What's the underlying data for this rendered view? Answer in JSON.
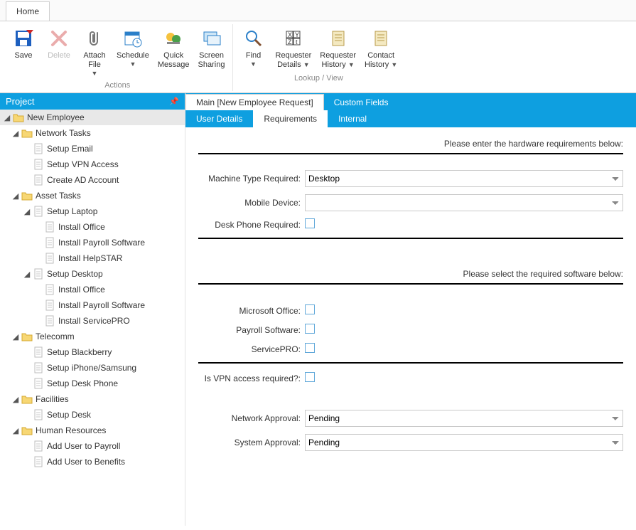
{
  "ribbon": {
    "tab": "Home",
    "buttons": {
      "save": "Save",
      "delete": "Delete",
      "attach": "Attach\nFile",
      "schedule": "Schedule",
      "quickmsg": "Quick\nMessage",
      "screen": "Screen\nSharing",
      "find": "Find",
      "reqdetails": "Requester\nDetails",
      "reqhistory": "Requester\nHistory",
      "contacthistory": "Contact\nHistory"
    },
    "group_actions": "Actions",
    "group_lookup": "Lookup / View"
  },
  "sidebar": {
    "title": "Project",
    "root": "New Employee",
    "items": [
      {
        "label": "Network Tasks",
        "children": [
          "Setup Email",
          "Setup VPN Access",
          "Create AD Account"
        ]
      },
      {
        "label": "Asset Tasks",
        "children": [
          {
            "label": "Setup Laptop",
            "children": [
              "Install Office",
              "Install Payroll Software",
              "Install HelpSTAR"
            ]
          },
          {
            "label": "Setup Desktop",
            "children": [
              "Install Office",
              "Install Payroll Software",
              "Install ServicePRO"
            ]
          }
        ]
      },
      {
        "label": "Telecomm",
        "children": [
          "Setup Blackberry",
          "Setup iPhone/Samsung",
          "Setup Desk Phone"
        ]
      },
      {
        "label": "Facilities",
        "children": [
          "Setup Desk"
        ]
      },
      {
        "label": "Human Resources",
        "children": [
          "Add User to Payroll",
          "Add User to Benefits"
        ]
      }
    ]
  },
  "tabs": {
    "main": "Main [New Employee Request]",
    "custom": "Custom Fields",
    "sub_user": "User Details",
    "sub_req": "Requirements",
    "sub_internal": "Internal"
  },
  "form": {
    "intro_hw": "Please enter the hardware requirements below:",
    "machine_type_label": "Machine Type Required:",
    "machine_type_value": "Desktop",
    "mobile_label": "Mobile Device:",
    "mobile_value": "",
    "desk_phone_label": "Desk Phone Required:",
    "intro_sw": "Please select the required software below:",
    "office_label": "Microsoft Office:",
    "payroll_label": "Payroll Software:",
    "servicepro_label": "ServicePRO:",
    "vpn_label": "Is VPN access required?:",
    "net_approval_label": "Network Approval:",
    "net_approval_value": "Pending",
    "sys_approval_label": "System Approval:",
    "sys_approval_value": "Pending"
  }
}
